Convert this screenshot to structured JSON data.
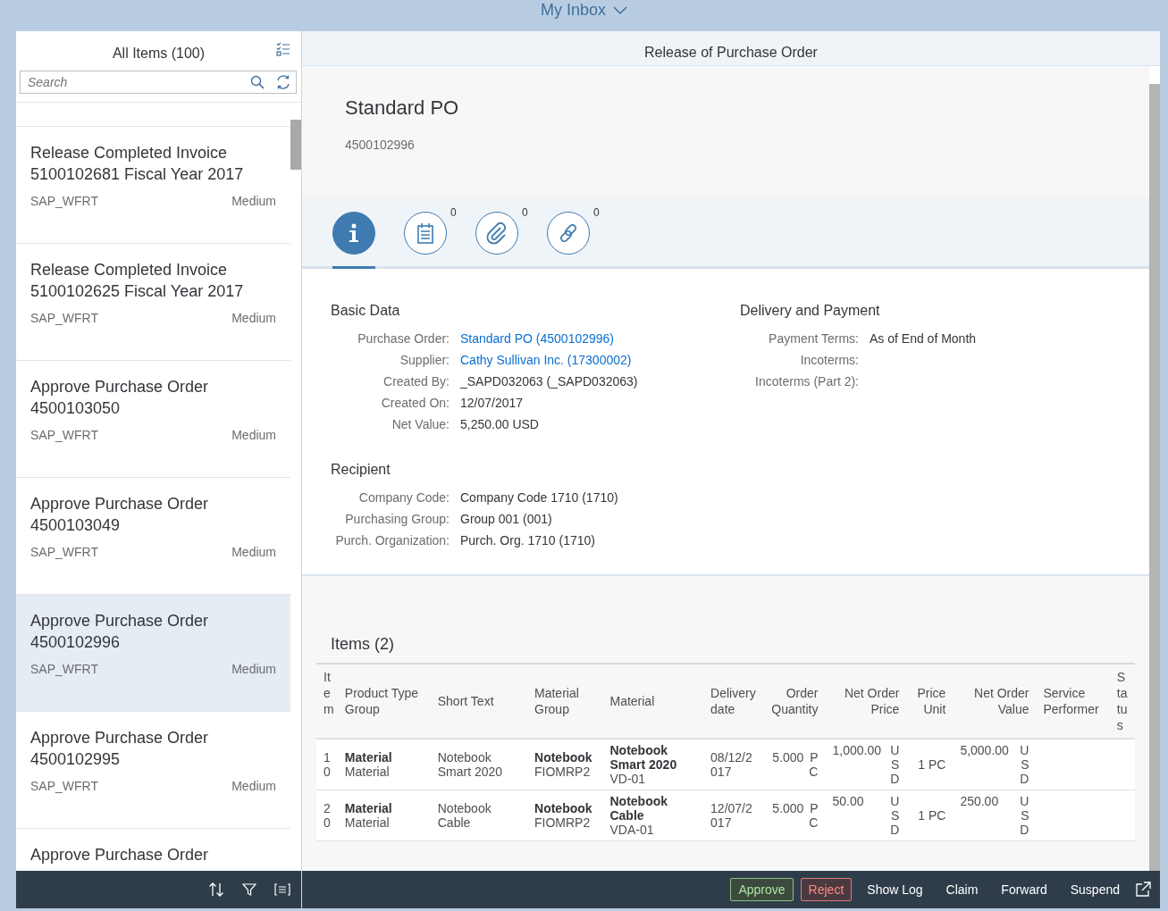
{
  "shell": {
    "title": "My Inbox"
  },
  "list": {
    "title": "All Items (100)",
    "search": {
      "placeholder": "Search"
    },
    "items": [
      {
        "title": "Release Completed Invoice 5100102681 Fiscal Year 2017",
        "creator": "SAP_WFRT",
        "priority": "Medium",
        "selected": false
      },
      {
        "title": "Release Completed Invoice 5100102625 Fiscal Year 2017",
        "creator": "SAP_WFRT",
        "priority": "Medium",
        "selected": false
      },
      {
        "title": "Approve Purchase Order 4500103050",
        "creator": "SAP_WFRT",
        "priority": "Medium",
        "selected": false
      },
      {
        "title": "Approve Purchase Order 4500103049",
        "creator": "SAP_WFRT",
        "priority": "Medium",
        "selected": false
      },
      {
        "title": "Approve Purchase Order 4500102996",
        "creator": "SAP_WFRT",
        "priority": "Medium",
        "selected": true
      },
      {
        "title": "Approve Purchase Order 4500102995",
        "creator": "SAP_WFRT",
        "priority": "Medium",
        "selected": false
      },
      {
        "title": "Approve Purchase Order",
        "selected": false
      }
    ]
  },
  "detail": {
    "title": "Release of Purchase Order",
    "heading": "Standard PO",
    "number": "4500102996",
    "tabs": [
      {
        "kind": "info",
        "selected": true
      },
      {
        "kind": "notes",
        "count": "0",
        "selected": false
      },
      {
        "kind": "attachments",
        "count": "0",
        "selected": false
      },
      {
        "kind": "links",
        "count": "0",
        "selected": false
      }
    ],
    "groups": [
      {
        "title": "Basic Data",
        "fields": [
          {
            "label": "Purchase Order:",
            "value": "Standard PO (4500102996)",
            "link": true
          },
          {
            "label": "Supplier:",
            "value": "Cathy Sullivan Inc. (17300002)",
            "link": true
          },
          {
            "label": "Created By:",
            "value": "_SAPD032063 (_SAPD032063)",
            "link": false
          },
          {
            "label": "Created On:",
            "value": "12/07/2017",
            "link": false
          },
          {
            "label": "Net Value:",
            "value": "5,250.00  USD",
            "link": false
          }
        ]
      },
      {
        "title": "Delivery and Payment",
        "fields": [
          {
            "label": "Payment Terms:",
            "value": "As of End of Month",
            "link": false
          },
          {
            "label": "Incoterms:"
          },
          {
            "label": "Incoterms (Part 2):"
          }
        ]
      },
      {
        "title": "Recipient",
        "fields": [
          {
            "label": "Company Code:",
            "value": "Company Code 1710 (1710)",
            "link": false
          },
          {
            "label": "Purchasing Group:",
            "value": "Group 001 (001)",
            "link": false
          },
          {
            "label": "Purch. Organization:",
            "value": "Purch. Org. 1710 (1710)",
            "link": false
          }
        ]
      }
    ],
    "items": {
      "title": "Items (2)",
      "columns": [
        {
          "label": "Item",
          "numeric": false
        },
        {
          "label": "Product Type Group",
          "numeric": false
        },
        {
          "label": "Short Text",
          "numeric": false
        },
        {
          "label": "Material Group",
          "numeric": false
        },
        {
          "label": "Material",
          "numeric": false
        },
        {
          "label": "Delivery date",
          "numeric": false
        },
        {
          "label": "Order Quantity",
          "numeric": true
        },
        {
          "label": "Net Order Price",
          "numeric": true
        },
        {
          "label": "Price Unit",
          "numeric": true
        },
        {
          "label": "Net Order Value",
          "numeric": true
        },
        {
          "label": "Service Performer",
          "numeric": false
        },
        {
          "label": "Status",
          "numeric": false
        }
      ],
      "rows": [
        [
          {
            "text": "10"
          },
          {
            "bold": "Material",
            "text": "Material"
          },
          {
            "text": "Notebook Smart 2020"
          },
          {
            "bold": "Notebook",
            "text": "FIOMRP2"
          },
          {
            "bold": "Notebook Smart 2020",
            "text": "VD-01"
          },
          {
            "text": "08/12/2017"
          },
          {
            "amount": "5.000",
            "unit": "PC"
          },
          {
            "amount": "1,000.00",
            "unit": "USD"
          },
          {
            "text": "1 PC"
          },
          {
            "amount": "5,000.00",
            "unit": "USD"
          },
          {},
          {}
        ],
        [
          {
            "text": "20"
          },
          {
            "bold": "Material",
            "text": "Material"
          },
          {
            "text": "Notebook Cable"
          },
          {
            "bold": "Notebook",
            "text": "FIOMRP2"
          },
          {
            "bold": "Notebook Cable",
            "text": "VDA-01"
          },
          {
            "text": "12/07/2017"
          },
          {
            "amount": "5.000",
            "unit": "PC"
          },
          {
            "amount": "50.00",
            "unit": "USD"
          },
          {
            "text": "1 PC"
          },
          {
            "amount": "250.00",
            "unit": "USD"
          },
          {},
          {}
        ]
      ]
    }
  },
  "actions": [
    {
      "label": "Approve",
      "kind": "positive"
    },
    {
      "label": "Reject",
      "kind": "negative"
    },
    {
      "label": "Show Log",
      "kind": "plain"
    },
    {
      "label": "Claim",
      "kind": "plain"
    },
    {
      "label": "Forward",
      "kind": "plain"
    },
    {
      "label": "Suspend",
      "kind": "plain"
    }
  ]
}
